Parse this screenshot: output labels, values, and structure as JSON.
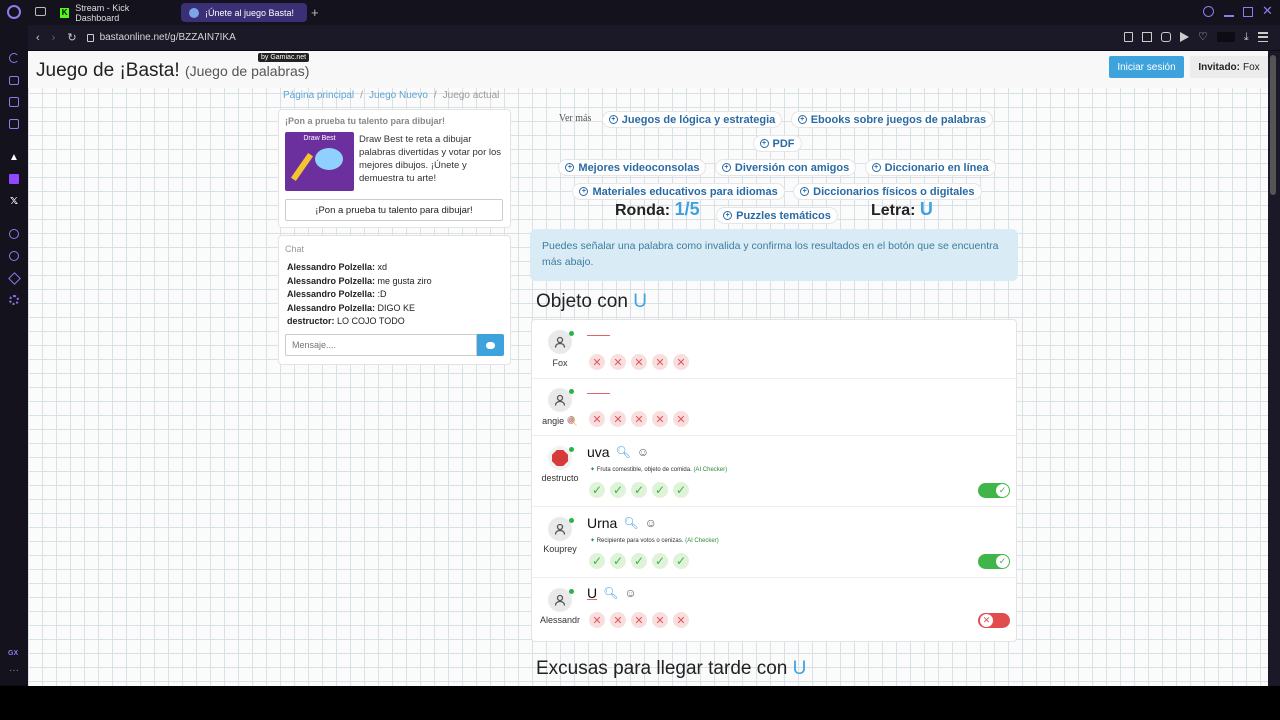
{
  "browser": {
    "tabs": [
      {
        "label": "Stream - Kick Dashboard"
      },
      {
        "label": "¡Únete al juego Basta!"
      }
    ],
    "url": "bastaonline.net/g/BZZAIN7IKA",
    "tooltip": "by Gamiac.net",
    "rail_bottom_label": "GX"
  },
  "header": {
    "title": "Juego de ¡Basta!",
    "subtitle": "(Juego de palabras)",
    "login_button": "Iniciar sesión",
    "guest_label": "Invitado:",
    "guest_name": "Fox"
  },
  "breadcrumb": {
    "items": [
      "Página principal",
      "Juego Nuevo",
      "Juego actual"
    ]
  },
  "promo": {
    "heading": "¡Pon a prueba tu talento para dibujar!",
    "image_title": "Draw Best",
    "text": "Draw Best te reta a dibujar palabras divertidas y votar por los mejores dibujos. ¡Únete y demuestra tu arte!",
    "button": "¡Pon a prueba tu talento para dibujar!"
  },
  "chat": {
    "title": "Chat",
    "messages": [
      {
        "user": "Alessandro Polzella:",
        "text": "xd"
      },
      {
        "user": "Alessandro Polzella:",
        "text": "me gusta ziro"
      },
      {
        "user": "Alessandro Polzella:",
        "text": ":D"
      },
      {
        "user": "Alessandro Polzella:",
        "text": "DIGO KE"
      },
      {
        "user": "destructor:",
        "text": "LO COJO TODO"
      }
    ],
    "placeholder": "Mensaje...."
  },
  "more": {
    "label": "Ver más",
    "links": [
      "Juegos de lógica y estrategia",
      "Ebooks sobre juegos de palabras",
      "PDF",
      "Mejores videoconsolas",
      "Diversión con amigos",
      "Diccionario en línea",
      "Materiales educativos para idiomas",
      "Diccionarios físicos o digitales",
      "Puzzles temáticos"
    ]
  },
  "game": {
    "round_label": "Ronda:",
    "round_value": "1/5",
    "letter_label": "Letra:",
    "letter_value": "U",
    "info": "Puedes señalar una palabra como invalida y confirma los resultados en el botón que se encuentra más abajo."
  },
  "category": {
    "title": "Objeto con",
    "letter": "U",
    "rows": [
      {
        "user": "Fox",
        "word": "",
        "hint": "",
        "hint_src": "",
        "votes": [
          "x",
          "x",
          "x",
          "x",
          "x"
        ],
        "toggle": null
      },
      {
        "user": "angie 🍭",
        "word": "",
        "hint": "",
        "hint_src": "",
        "votes": [
          "x",
          "x",
          "x",
          "x",
          "x"
        ],
        "toggle": null
      },
      {
        "user": "destructo",
        "word": "uva",
        "hint": "Fruta comestible, objeto de comida.",
        "hint_src": "(AI Checker)",
        "votes": [
          "v",
          "v",
          "v",
          "v",
          "v"
        ],
        "toggle": "on"
      },
      {
        "user": "Kouprey",
        "word": "Urna",
        "hint": "Recipiente para votos o cenizas.",
        "hint_src": "(AI Checker)",
        "votes": [
          "v",
          "v",
          "v",
          "v",
          "v"
        ],
        "toggle": "on"
      },
      {
        "user": "Alessandr",
        "word": "U",
        "hint": "",
        "hint_src": "",
        "votes": [
          "x",
          "x",
          "x",
          "x",
          "x"
        ],
        "toggle": "off"
      }
    ]
  },
  "next_category": {
    "title": "Excusas para llegar tarde con",
    "letter": "U"
  },
  "colors": {
    "accent_blue": "#3ea3dc",
    "check_green": "#40b549",
    "error_red": "#e14d4f",
    "info_bg": "#d9ecf5"
  }
}
